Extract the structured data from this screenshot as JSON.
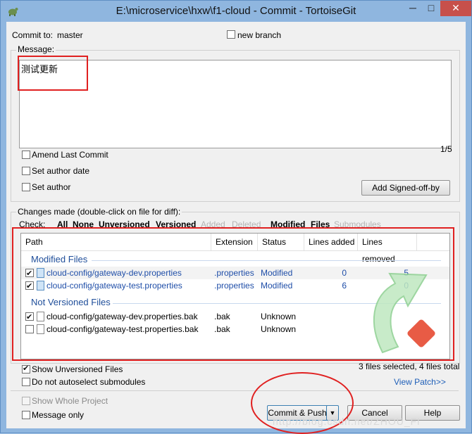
{
  "window": {
    "title": "E:\\microservice\\hxw\\f1-cloud - Commit - TortoiseGit",
    "minimize": "─",
    "maximize": "□",
    "close": "✕"
  },
  "commit_to": {
    "label": "Commit to:",
    "branch": "master"
  },
  "new_branch": {
    "label": "new branch",
    "checked": false
  },
  "message": {
    "label": "Message:",
    "text": "测试更新",
    "counter": "1/5"
  },
  "options": {
    "amend": "Amend Last Commit",
    "set_author_date": "Set author date",
    "set_author": "Set author",
    "add_signed_off": "Add Signed-off-by"
  },
  "changes": {
    "label": "Changes made (double-click on file for diff):",
    "check_label": "Check:",
    "filters": [
      {
        "label": "All",
        "enabled": true
      },
      {
        "label": "None",
        "enabled": true
      },
      {
        "label": "Unversioned",
        "enabled": true
      },
      {
        "label": "Versioned",
        "enabled": true
      },
      {
        "label": "Added",
        "enabled": false
      },
      {
        "label": "Deleted",
        "enabled": false
      },
      {
        "label": "Modified",
        "enabled": true
      },
      {
        "label": "Files",
        "enabled": true
      },
      {
        "label": "Submodules",
        "enabled": false
      }
    ],
    "columns": [
      "Path",
      "Extension",
      "Status",
      "Lines added",
      "Lines removed"
    ],
    "groups": [
      {
        "name": "Modified Files",
        "rows": [
          {
            "path": "cloud-config/gateway-dev.properties",
            "ext": ".properties",
            "status": "Modified",
            "added": "0",
            "removed": "5",
            "checked": true
          },
          {
            "path": "cloud-config/gateway-test.properties",
            "ext": ".properties",
            "status": "Modified",
            "added": "6",
            "removed": "0",
            "checked": true
          }
        ]
      },
      {
        "name": "Not Versioned Files",
        "rows": [
          {
            "path": "cloud-config/gateway-dev.properties.bak",
            "ext": ".bak",
            "status": "Unknown",
            "added": "",
            "removed": "",
            "checked": true
          },
          {
            "path": "cloud-config/gateway-test.properties.bak",
            "ext": ".bak",
            "status": "Unknown",
            "added": "",
            "removed": "",
            "checked": false
          }
        ]
      }
    ],
    "summary": "3 files selected, 4 files total"
  },
  "bottom": {
    "show_unversioned": "Show Unversioned Files",
    "no_autoselect": "Do not autoselect submodules",
    "view_patch": "View Patch>>",
    "show_whole": "Show Whole Project",
    "message_only": "Message only",
    "commit_push": "Commit & Push",
    "cancel": "Cancel",
    "help": "Help"
  },
  "watermark": "http://blog.csdn.net/ZHOU_Fl",
  "colors": {
    "accent": "#1f4ea8",
    "annotation": "#e02020",
    "titlebar": "#8fb6df"
  }
}
